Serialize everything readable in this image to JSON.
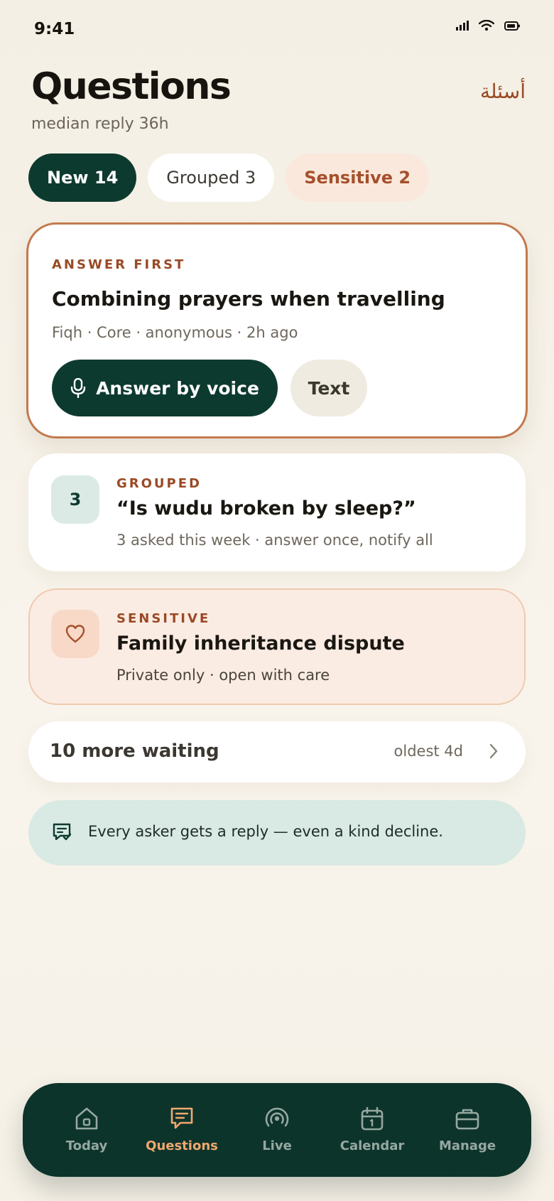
{
  "status_bar": {
    "time": "9:41"
  },
  "header": {
    "title": "Questions",
    "subtitle": "median reply 36h",
    "arabic_title": "أسئلة"
  },
  "filters": [
    {
      "label": "New 14",
      "active": true
    },
    {
      "label": "Grouped 3",
      "active": false
    },
    {
      "label": "Sensitive 2",
      "active": false
    }
  ],
  "featured": {
    "eyebrow": "ANSWER FIRST",
    "title": "Combining prayers when travelling",
    "meta": "Fiqh · Core · anonymous · 2h ago",
    "voice_button": "Answer by voice",
    "text_button": "Text"
  },
  "grouped": {
    "count": "3",
    "eyebrow": "GROUPED",
    "title": "“Is wudu broken by sleep?”",
    "meta": "3 asked this week · answer once, notify all"
  },
  "sensitive": {
    "eyebrow": "SENSITIVE",
    "title": "Family inheritance dispute",
    "meta": "Private only · open with care",
    "icon": "heart-icon"
  },
  "waiting": {
    "label": "10 more waiting",
    "meta": "oldest 4d"
  },
  "banner": {
    "text": "Every asker gets a reply — even a kind decline.",
    "icon": "chat-check-icon"
  },
  "tabbar": {
    "active": "Questions",
    "tabs": [
      {
        "label": "Today",
        "icon": "home-icon"
      },
      {
        "label": "Questions",
        "icon": "message-icon"
      },
      {
        "label": "Live",
        "icon": "broadcast-icon"
      },
      {
        "label": "Calendar",
        "icon": "calendar-icon"
      },
      {
        "label": "Manage",
        "icon": "briefcase-icon"
      }
    ]
  },
  "colors": {
    "primary": "#0d3a2f",
    "accent": "#9a4a25",
    "active_tab": "#f0a86f",
    "background": "#f4efe4"
  }
}
